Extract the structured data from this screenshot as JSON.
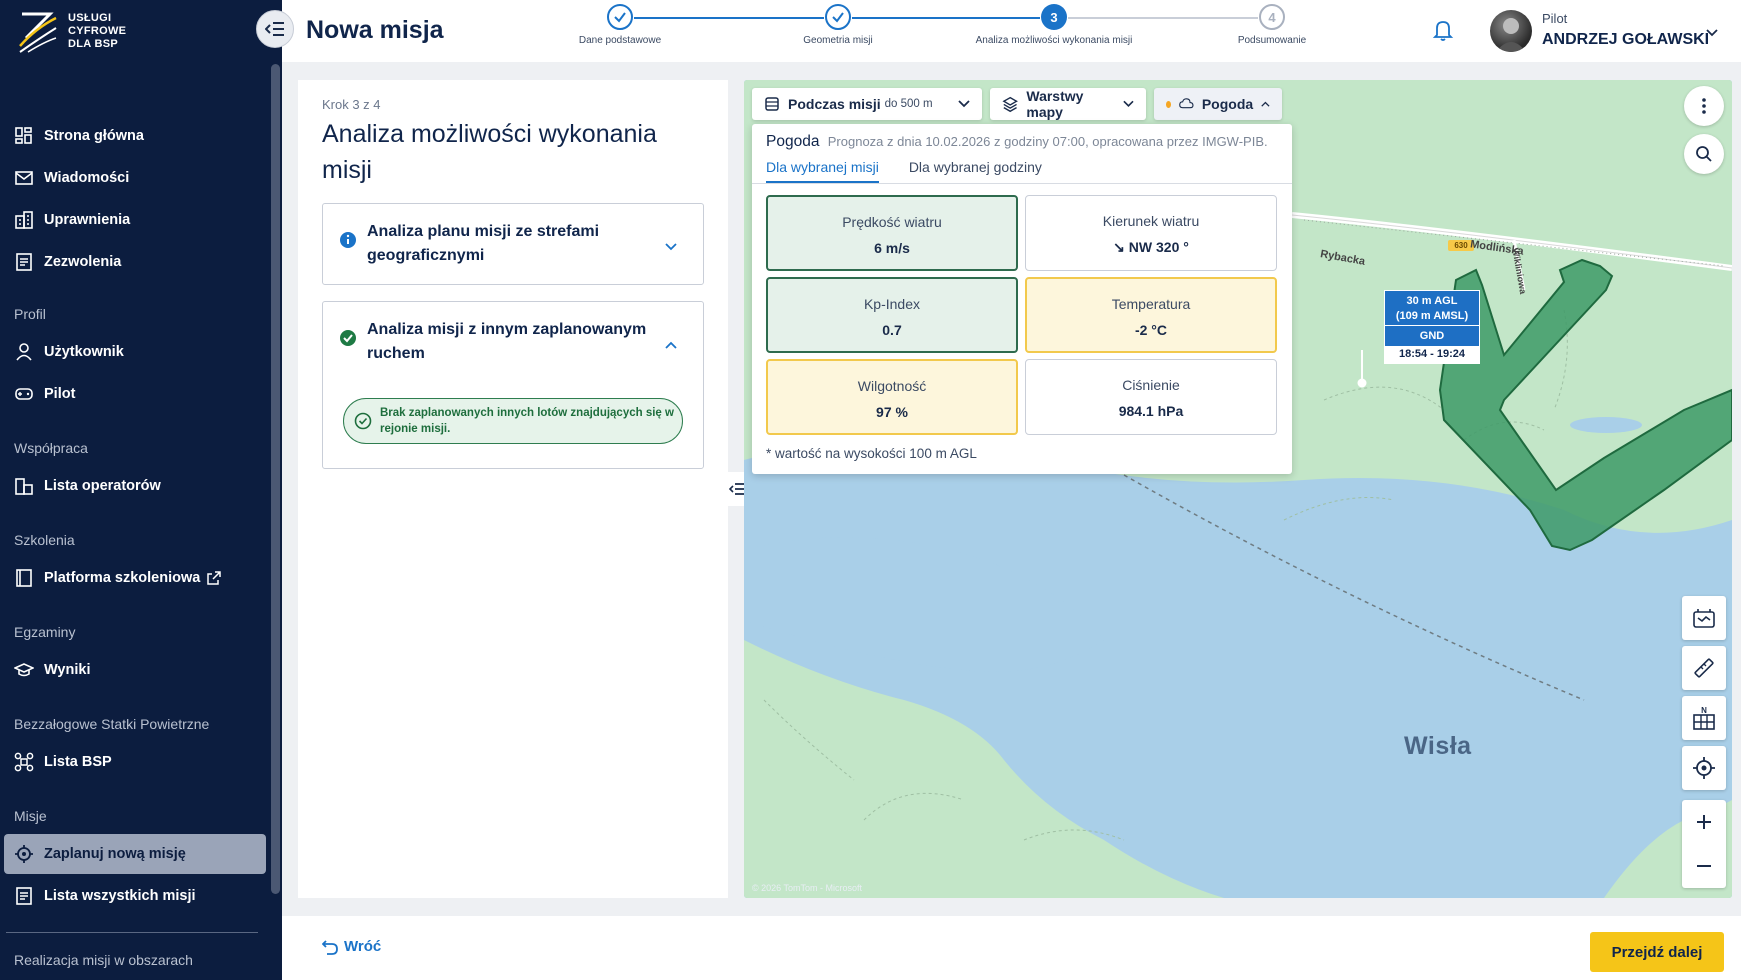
{
  "brand": {
    "line1": "USŁUGI",
    "line2": "CYFROWE",
    "line3": "DLA BSP"
  },
  "sidebar": {
    "main_items": [
      {
        "label": "Strona główna",
        "icon": "dashboard-icon"
      },
      {
        "label": "Wiadomości",
        "icon": "mail-icon"
      },
      {
        "label": "Uprawnienia",
        "icon": "permissions-icon"
      },
      {
        "label": "Zezwolenia",
        "icon": "document-icon"
      }
    ],
    "sections": {
      "profil": "Profil",
      "wspolpraca": "Współpraca",
      "szkolenia": "Szkolenia",
      "egzaminy": "Egzaminy",
      "bsp": "Bezzałogowe Statki Powietrzne",
      "misje": "Misje",
      "realizacja": "Realizacja misji w obszarach"
    },
    "profil_items": [
      {
        "label": "Użytkownik",
        "icon": "user-icon"
      },
      {
        "label": "Pilot",
        "icon": "gamepad-icon"
      }
    ],
    "wspolpraca_item": "Lista operatorów",
    "szkolenia_item": "Platforma szkoleniowa",
    "egzaminy_item": "Wyniki",
    "bsp_item": "Lista BSP",
    "misje_items": [
      {
        "label": "Zaplanuj nową misję",
        "active": true
      },
      {
        "label": "Lista wszystkich misji",
        "active": false
      }
    ]
  },
  "header": {
    "title": "Nowa misja",
    "steps": [
      {
        "number": "1",
        "label": "Dane podstawowe",
        "state": "done"
      },
      {
        "number": "2",
        "label": "Geometria misji",
        "state": "done"
      },
      {
        "number": "3",
        "label": "Analiza możliwości wykonania misji",
        "state": "current"
      },
      {
        "number": "4",
        "label": "Podsumowanie",
        "state": "future"
      }
    ],
    "user_role": "Pilot",
    "user_name": "ANDRZEJ GOŁAWSKI"
  },
  "panel": {
    "step_caption": "Krok 3 z 4",
    "title": "Analiza możliwości wykonania misji",
    "cards": [
      {
        "title": "Analiza planu misji ze strefami geograficznymi",
        "status": "info",
        "expanded": false
      },
      {
        "title": "Analiza misji z innym zaplanowanym ruchem",
        "status": "success",
        "expanded": true
      }
    ],
    "notice": "Brak zaplanowanych innych lotów znajdujących się w rejonie misji."
  },
  "map": {
    "controls": {
      "during_label": "Podczas misji",
      "during_range": "do 500 m",
      "layers_label": "Warstwy mapy",
      "weather_label": "Pogoda"
    },
    "river_label": "Wisła",
    "road_label_1": "Modlińska",
    "road_label_2": "Rybacka",
    "road_label_3": "Wikliniowa",
    "road_number": "630",
    "attribution": "© 2026 TomTom - Microsoft",
    "marker": {
      "agl": "30 m AGL",
      "amsl": "(109 m AMSL)",
      "ground": "GND",
      "time": "18:54 - 19:24"
    }
  },
  "weather": {
    "title": "Pogoda",
    "subtitle": "Prognoza z dnia 10.02.2026 z godziny 07:00, opracowana przez IMGW-PIB.",
    "tabs": [
      "Dla wybranej misji",
      "Dla wybranej godziny"
    ],
    "cells": [
      {
        "label": "Prędkość wiatru",
        "value": "6 m/s",
        "status": "green"
      },
      {
        "label": "Kierunek wiatru",
        "value": "↘ NW 320 °",
        "status": "neutral"
      },
      {
        "label": "Kp-Index",
        "value": "0.7",
        "status": "green"
      },
      {
        "label": "Temperatura",
        "value": "-2 °C",
        "status": "yellow"
      },
      {
        "label": "Wilgotność",
        "value": "97 %",
        "status": "yellow"
      },
      {
        "label": "Ciśnienie",
        "value": "984.1 hPa",
        "status": "neutral"
      }
    ],
    "note": "* wartość na wysokości 100 m AGL"
  },
  "footer": {
    "back_label": "Wróć",
    "next_label": "Przejdź dalej"
  },
  "colors": {
    "sidebar_bg": "#0c1d3f",
    "accent": "#1a73c8",
    "primary_button": "#f5c518",
    "success": "#2e7d4f",
    "warning": "#f2c94c"
  }
}
